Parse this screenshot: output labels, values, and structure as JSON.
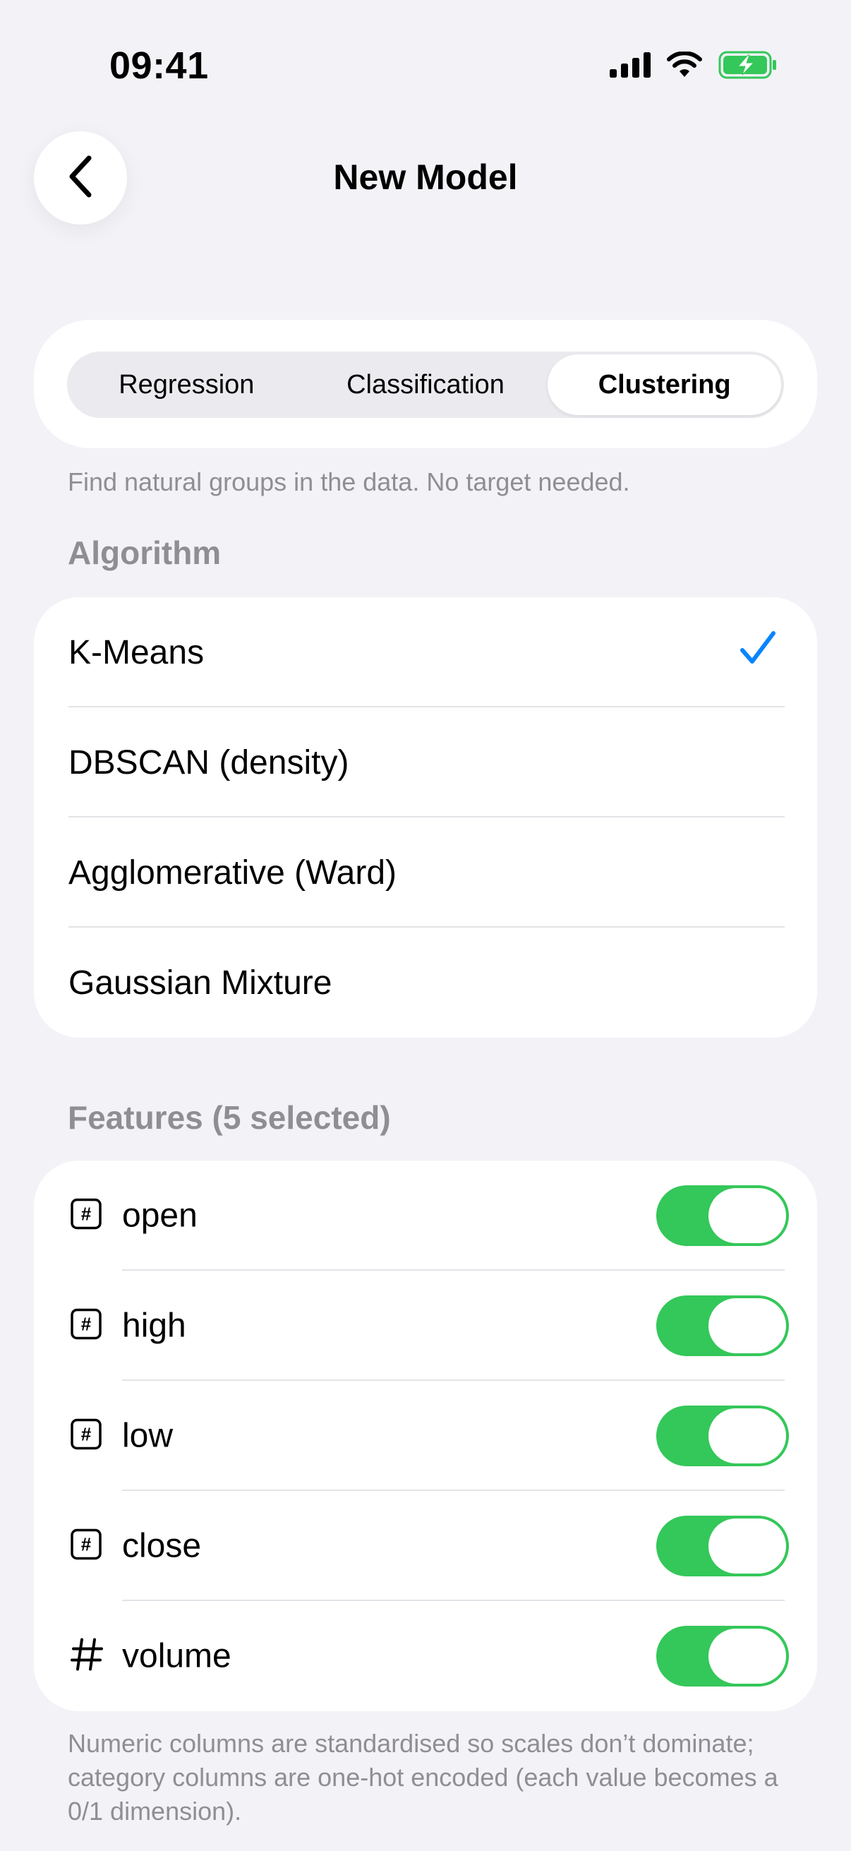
{
  "status_bar": {
    "time": "09:41"
  },
  "nav": {
    "title": "New Model"
  },
  "segments": {
    "items": [
      "Regression",
      "Classification",
      "Clustering"
    ],
    "selected": "Clustering"
  },
  "hint": "Find natural groups in the data. No target needed.",
  "algorithm": {
    "header": "Algorithm",
    "items": [
      "K-Means",
      "DBSCAN (density)",
      "Agglomerative (Ward)",
      "Gaussian Mixture"
    ],
    "selected": "K-Means"
  },
  "features": {
    "header": "Features (5 selected)",
    "items": [
      {
        "label": "open",
        "icon": "number-square-icon",
        "enabled": true
      },
      {
        "label": "high",
        "icon": "number-square-icon",
        "enabled": true
      },
      {
        "label": "low",
        "icon": "number-square-icon",
        "enabled": true
      },
      {
        "label": "close",
        "icon": "number-square-icon",
        "enabled": true
      },
      {
        "label": "volume",
        "icon": "number-sign-icon",
        "enabled": true
      }
    ]
  },
  "footer_note": "Numeric columns are standardised so scales don’t dominate; category columns are one-hot encoded (each value becomes a 0/1 dimension).",
  "colors": {
    "background": "#F2F2F7",
    "accent": "#0A84FF",
    "toggle_on": "#34C759",
    "secondary_text": "#8E8E93"
  }
}
